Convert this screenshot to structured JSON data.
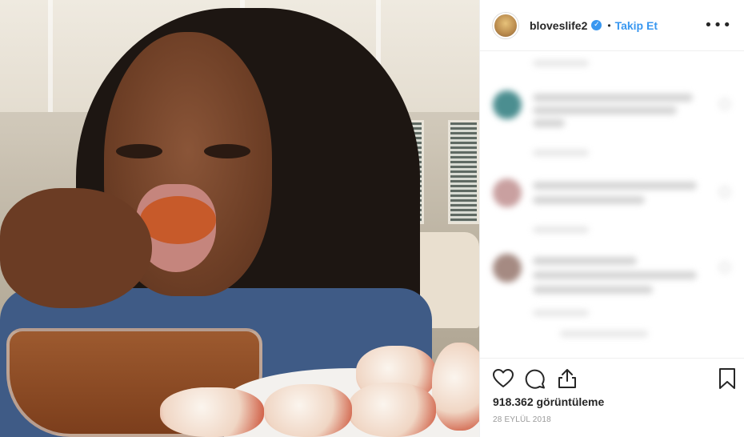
{
  "post": {
    "username": "bloveslife2",
    "verified_glyph": "✓",
    "separator": "•",
    "follow_label": "Takip Et",
    "more_icon": "•••",
    "views_text": "918.362 görüntüleme",
    "date_text": "28 EYLÜL 2018"
  },
  "icons": {
    "like": "heart-icon",
    "comment": "comment-icon",
    "share": "share-icon",
    "save": "bookmark-icon",
    "more": "more-options-icon"
  },
  "colors": {
    "accent": "#3897f0",
    "text": "#262626",
    "muted": "#999999",
    "border": "#efefef"
  }
}
